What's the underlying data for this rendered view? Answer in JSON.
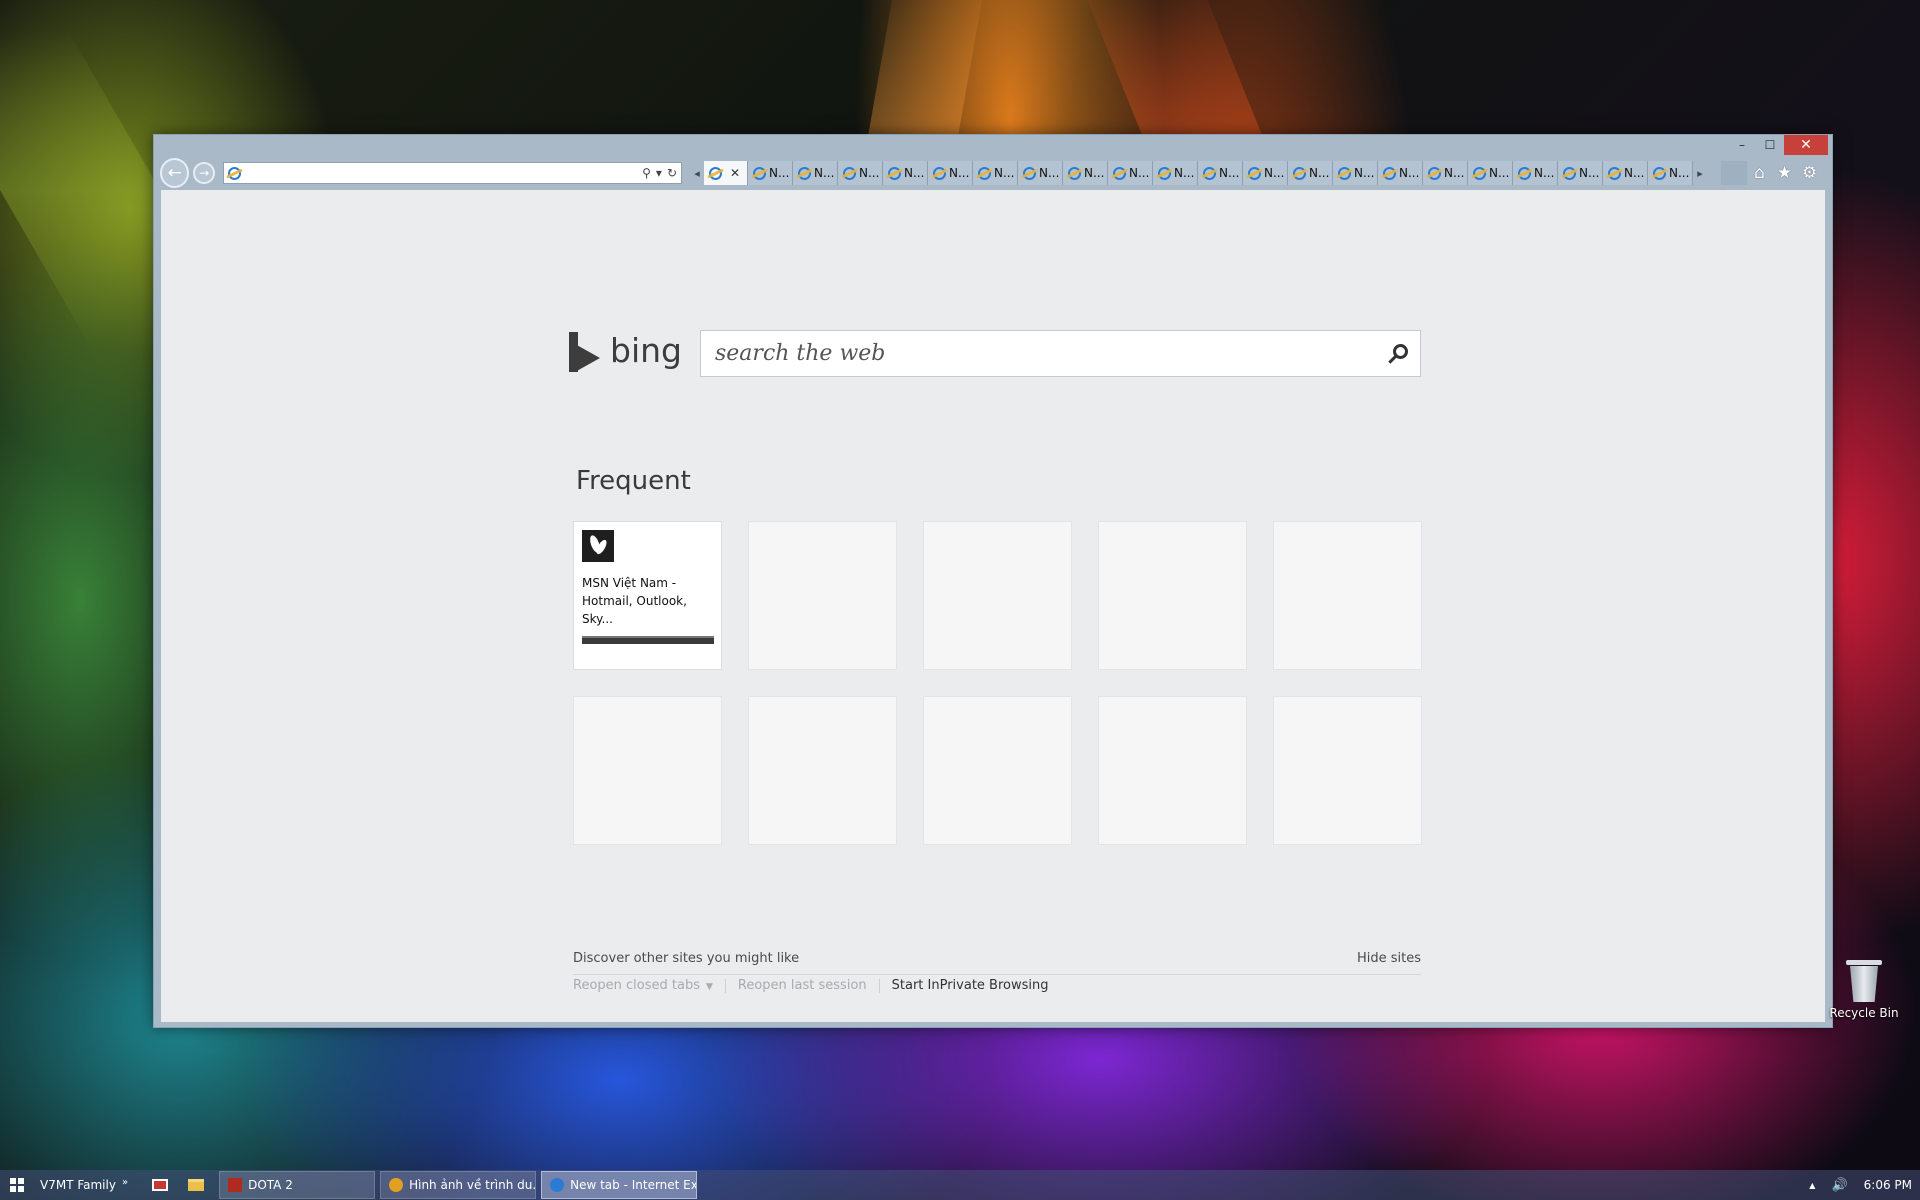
{
  "window": {
    "controls": {
      "minimize": "–",
      "maximize": "☐",
      "close": "✕"
    }
  },
  "browser": {
    "back_icon": "←",
    "forward_icon": "→",
    "address": {
      "value": "",
      "placeholder": ""
    },
    "address_icons": {
      "search": "⚲",
      "dropdown": "▾",
      "refresh": "↻"
    },
    "tab_scroll_left": "◂",
    "tab_scroll_right": "▸",
    "tabs": [
      {
        "label": "",
        "active": true,
        "close": "✕"
      },
      {
        "label": "N..."
      },
      {
        "label": "N..."
      },
      {
        "label": "N..."
      },
      {
        "label": "N..."
      },
      {
        "label": "N..."
      },
      {
        "label": "N..."
      },
      {
        "label": "N..."
      },
      {
        "label": "N..."
      },
      {
        "label": "N..."
      },
      {
        "label": "N..."
      },
      {
        "label": "N..."
      },
      {
        "label": "N..."
      },
      {
        "label": "N..."
      },
      {
        "label": "N..."
      },
      {
        "label": "N..."
      },
      {
        "label": "N..."
      },
      {
        "label": "N..."
      },
      {
        "label": "N..."
      },
      {
        "label": "N..."
      },
      {
        "label": "N..."
      },
      {
        "label": "N..."
      }
    ],
    "command_icons": {
      "home": "⌂",
      "favorites": "★",
      "tools": "⚙"
    }
  },
  "page": {
    "logo_text": "bing",
    "search": {
      "placeholder": "search the web",
      "value": ""
    },
    "frequent_title": "Frequent",
    "tiles": [
      {
        "title": "MSN Việt Nam - Hotmail, Outlook, Sky...",
        "filled": true
      },
      {
        "title": ""
      },
      {
        "title": ""
      },
      {
        "title": ""
      },
      {
        "title": ""
      },
      {
        "title": ""
      },
      {
        "title": ""
      },
      {
        "title": ""
      },
      {
        "title": ""
      },
      {
        "title": ""
      }
    ],
    "discover_text": "Discover other sites you might like",
    "hide_sites": "Hide sites",
    "reopen_closed_tabs": "Reopen closed tabs",
    "reopen_last_session": "Reopen last session",
    "start_inprivate": "Start InPrivate Browsing"
  },
  "desktop": {
    "recycle_bin_label": "Recycle Bin"
  },
  "taskbar": {
    "toolbar_label": "V7MT Family",
    "toolbar_chevron": "»",
    "items": [
      {
        "label": "DOTA 2",
        "icon_color": "#b02a20"
      },
      {
        "label": "Hình ảnh về trình du...",
        "icon_color": "#e0a020"
      },
      {
        "label": "New tab - Internet Ex...",
        "icon_color": "#2a7bd4",
        "active": true
      }
    ],
    "tray_up": "▲",
    "volume": "🔊",
    "clock": "6:06 PM"
  }
}
